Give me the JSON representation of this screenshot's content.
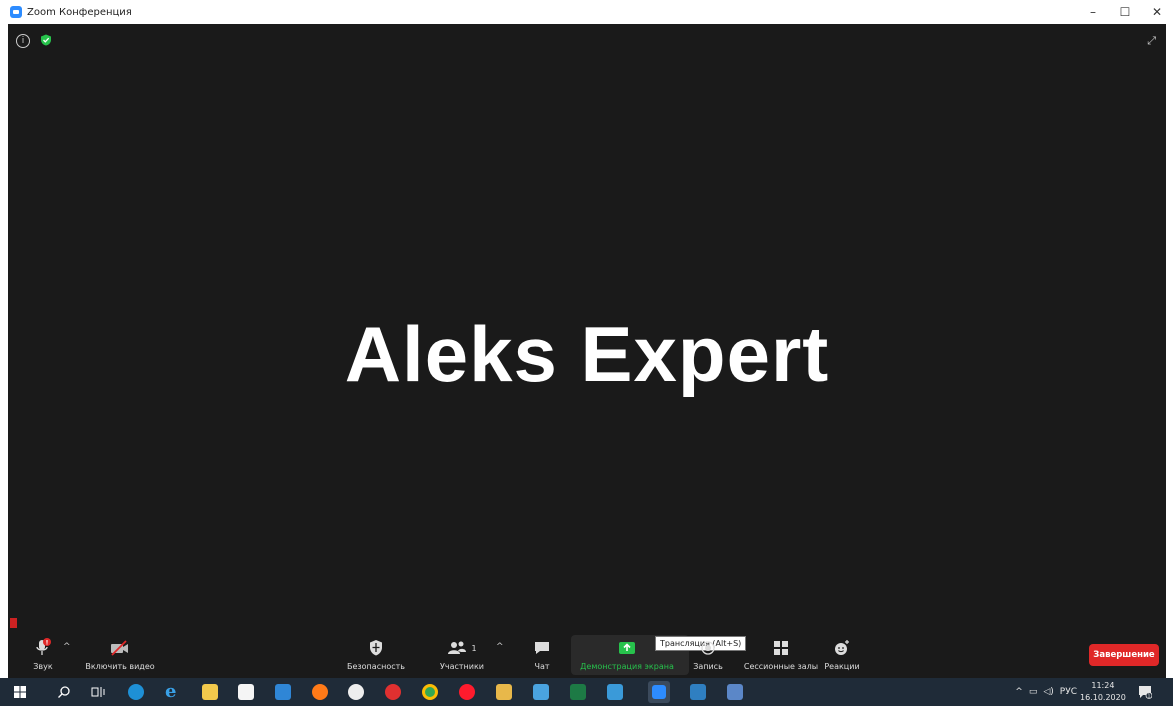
{
  "window": {
    "title": "Zoom Конференция",
    "controls": [
      "–",
      "☐",
      "✕"
    ]
  },
  "meeting": {
    "participant_name": "Aleks Expert",
    "info_symbol": "i"
  },
  "toolbar": {
    "audio_label": "Звук",
    "video_label": "Включить видео",
    "security_label": "Безопасность",
    "participants_label": "Участники",
    "participants_count": "1",
    "chat_label": "Чат",
    "share_label": "Демонстрация экрана",
    "share_tooltip": "Трансляция (Alt+S)",
    "record_label": "Запись",
    "breakout_label": "Сессионные залы",
    "reactions_label": "Реакции",
    "end_label": "Завершение"
  },
  "taskbar": {
    "language": "РУС",
    "time": "11:24",
    "date": "16.10.2020",
    "notification_count": "1",
    "icons": [
      "windows-start-icon",
      "search-icon",
      "task-view-icon",
      "edge-icon",
      "ie-icon",
      "file-explorer-icon",
      "store-icon",
      "mail-icon",
      "firefox-icon",
      "yandex-browser-icon",
      "yandex-icon",
      "chrome-icon",
      "opera-icon",
      "folder-icon",
      "app-icon",
      "excel-icon",
      "database-icon",
      "zoom-icon",
      "media-icon",
      "notes-icon"
    ]
  },
  "colors": {
    "stage_bg": "#1a1a1a",
    "accent_green": "#27c24c",
    "end_red": "#e02828",
    "taskbar_bg": "#1f2b38"
  }
}
